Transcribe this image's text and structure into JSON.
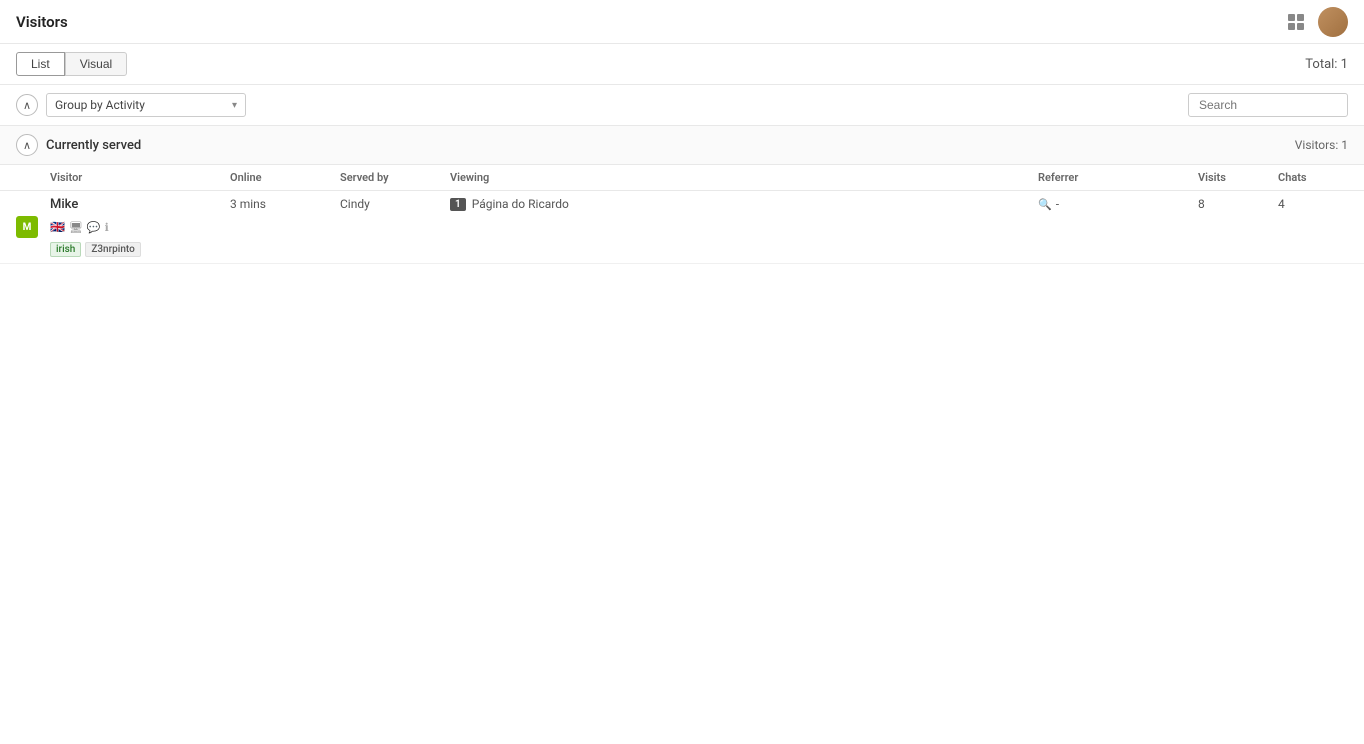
{
  "header": {
    "title": "Visitors",
    "total_label": "Total: 1"
  },
  "tabs": {
    "list_label": "List",
    "visual_label": "Visual",
    "active": "list"
  },
  "filter": {
    "group_by_label": "Group by Activity",
    "search_placeholder": "Search",
    "collapse_icon": "∧"
  },
  "section": {
    "title": "Currently served",
    "count_label": "Visitors: 1",
    "collapse_icon": "∧"
  },
  "table": {
    "columns": {
      "visitor": "Visitor",
      "online": "Online",
      "served_by": "Served by",
      "viewing": "Viewing",
      "referrer": "Referrer",
      "visits": "Visits",
      "chats": "Chats"
    }
  },
  "rows": [
    {
      "id": 1,
      "visitor_initials": "M",
      "visitor_name": "Mike",
      "tags": [
        "irish",
        "Z3nrpinto"
      ],
      "flag": "🇬🇧",
      "has_desktop": true,
      "has_mobile": true,
      "has_info": true,
      "online": "3 mins",
      "served_by": "Cindy",
      "page_num": "1",
      "viewing": "Página do Ricardo",
      "referrer": "-",
      "visits": "8",
      "chats": "4"
    }
  ]
}
